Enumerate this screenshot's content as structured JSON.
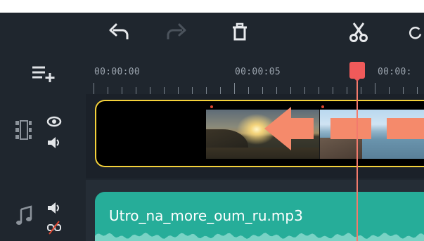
{
  "toolbar": {
    "undo_icon": "undo-icon",
    "redo_icon": "redo-icon",
    "delete_icon": "trash-icon",
    "cut_icon": "scissors-icon",
    "rotate_icon": "rotate-icon"
  },
  "timeline": {
    "add_track_icon": "add-track-icon",
    "ruler": {
      "labels": [
        "00:00:00",
        "00:00:05",
        "00:00:"
      ]
    },
    "playhead_color": "#f05a5a"
  },
  "video_track": {
    "icons": [
      "film-strip-icon",
      "eye-icon",
      "speaker-icon"
    ],
    "clip_border_color": "#f5d23b",
    "annotation_color": "#f58a6b"
  },
  "audio_track": {
    "icons": [
      "music-note-icon",
      "speaker-icon",
      "link-broken-icon"
    ],
    "clip": {
      "name": "Utro_na_more_oum_ru.mp3",
      "color": "#26ad99"
    }
  }
}
